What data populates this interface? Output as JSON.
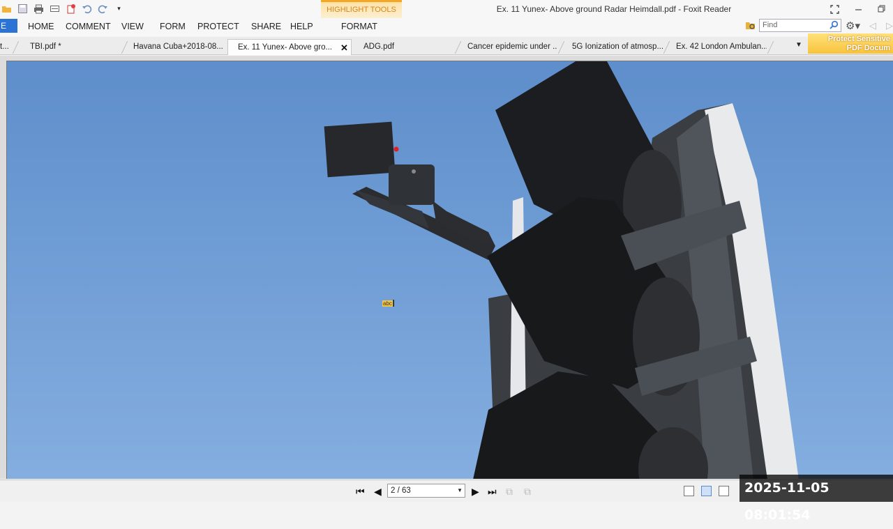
{
  "window": {
    "title": "Ex. 11 Yunex- Above ground Radar Heimdall.pdf - Foxit Reader",
    "contextual_tab": "HIGHLIGHT TOOLS"
  },
  "ribbon": {
    "file_label": "E",
    "menu": [
      "HOME",
      "COMMENT",
      "VIEW",
      "FORM",
      "PROTECT",
      "SHARE",
      "HELP",
      "FORMAT"
    ],
    "find_placeholder": "Find"
  },
  "tabs": [
    {
      "label": "t..."
    },
    {
      "label": "TBI.pdf *"
    },
    {
      "label": "Havana Cuba+2018-08..."
    },
    {
      "label": "Ex. 11 Yunex- Above gro...",
      "active": true
    },
    {
      "label": "ADG.pdf"
    },
    {
      "label": "Cancer epidemic under ..."
    },
    {
      "label": "5G Ionization of atmosp..."
    },
    {
      "label": "Ex. 42 London Ambulan..."
    }
  ],
  "promo": {
    "line1": "Protect Sensitive",
    "line2": "PDF Docum"
  },
  "cursor": {
    "note_text": "abc"
  },
  "statusbar": {
    "page_field": "2 / 63"
  },
  "overlay": {
    "timestamp": "2025-11-05  08:01:54"
  },
  "colors": {
    "accent": "#2b74d6",
    "highlight": "#f5a623",
    "sky_top": "#5e8ecb",
    "sky_bottom": "#84aee0"
  }
}
